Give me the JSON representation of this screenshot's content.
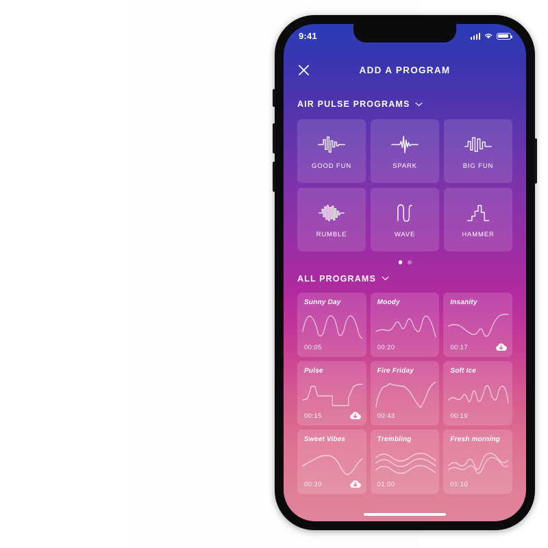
{
  "status_bar": {
    "time": "9:41",
    "signal_icon": "signal-bars-icon",
    "wifi_icon": "wifi-icon",
    "battery_icon": "battery-icon"
  },
  "nav": {
    "close_icon": "close-icon",
    "title": "ADD A PROGRAM"
  },
  "sections": {
    "air_pulse": {
      "label": "AIR PULSE PROGRAMS",
      "chevron_icon": "chevron-down-icon",
      "items": [
        {
          "name": "GOOD FUN",
          "icon": "waveform-good-fun-icon"
        },
        {
          "name": "SPARK",
          "icon": "waveform-spark-icon"
        },
        {
          "name": "BIG FUN",
          "icon": "waveform-big-fun-icon"
        },
        {
          "name": "RUMBLE",
          "icon": "waveform-rumble-icon"
        },
        {
          "name": "WAVE",
          "icon": "waveform-wave-icon"
        },
        {
          "name": "HAMMER",
          "icon": "waveform-hammer-icon"
        }
      ],
      "pagination": {
        "total": 2,
        "active": 1
      }
    },
    "all_programs": {
      "label": "ALL PROGRAMS",
      "chevron_icon": "chevron-down-icon",
      "items": [
        {
          "title": "Sunny Day",
          "duration": "00:05",
          "downloadable": false
        },
        {
          "title": "Moody",
          "duration": "00:20",
          "downloadable": false
        },
        {
          "title": "Insanity",
          "duration": "00:17",
          "downloadable": true
        },
        {
          "title": "Pulse",
          "duration": "00:15",
          "downloadable": true
        },
        {
          "title": "Fire Friday",
          "duration": "00:43",
          "downloadable": false
        },
        {
          "title": "Soft Ice",
          "duration": "00:19",
          "downloadable": false
        },
        {
          "title": "Sweet Vibes",
          "duration": "00:20",
          "downloadable": true
        },
        {
          "title": "Trembling",
          "duration": "01:00",
          "downloadable": false
        },
        {
          "title": "Fresh morning",
          "duration": "01:10",
          "downloadable": false
        }
      ]
    }
  },
  "colors": {
    "gradient_top": "#2a3cb5",
    "gradient_mid": "#9a2ea6",
    "gradient_bottom": "#df8499",
    "card_surface": "rgba(255,255,255,0.14)",
    "text_on_dark": "#ffffff"
  },
  "home_indicator": "home-indicator"
}
